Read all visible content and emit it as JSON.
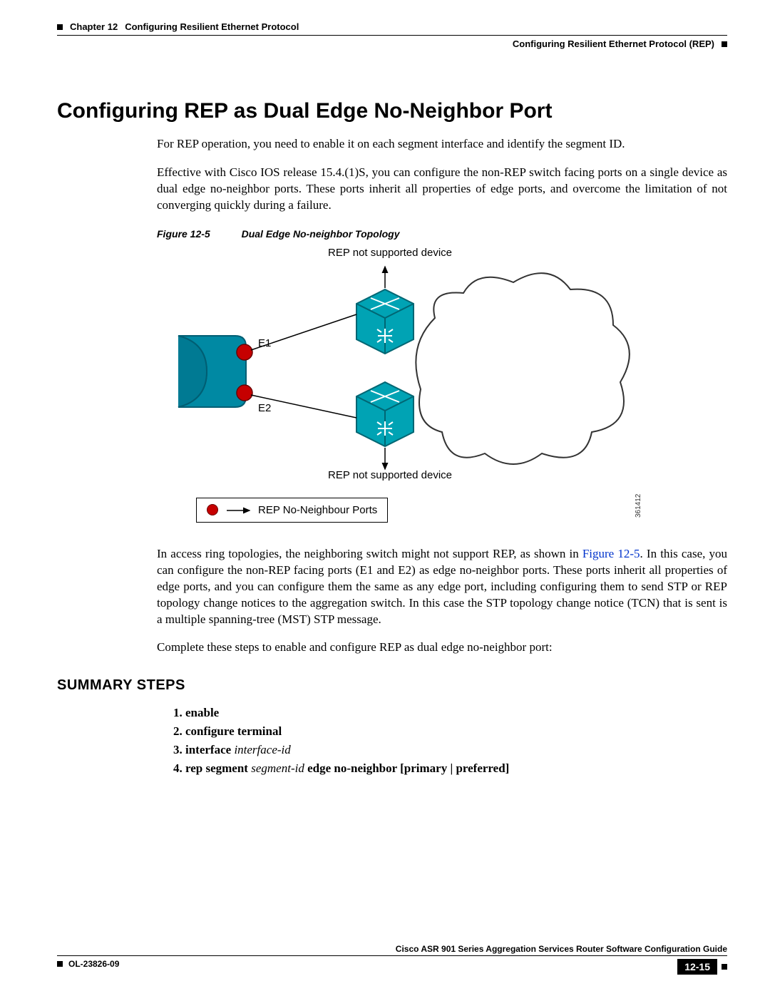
{
  "header": {
    "chapter": "Chapter 12",
    "chapter_title": "Configuring Resilient Ethernet Protocol",
    "breadcrumb": "Configuring Resilient Ethernet Protocol (REP)"
  },
  "section_title": "Configuring REP as Dual Edge No-Neighbor Port",
  "para1": "For REP operation, you need to enable it on each segment interface and identify the segment ID.",
  "para2": "Effective with Cisco IOS release 15.4.(1)S, you can configure the non-REP switch facing ports on a single device as dual edge no-neighbor ports. These ports inherit all properties of edge ports, and overcome the limitation of not converging quickly during a failure.",
  "figure": {
    "number": "Figure 12-5",
    "title": "Dual Edge No-neighbor Topology",
    "top_label": "REP not supported device",
    "bottom_label": "REP not supported device",
    "e1": "E1",
    "e2": "E2",
    "legend": "REP No-Neighbour Ports",
    "id": "361412"
  },
  "para3a": "In access ring topologies, the neighboring switch might not support REP, as shown in ",
  "para3_link": "Figure 12-5",
  "para3b": ". In this case, you can configure the non-REP facing ports (E1 and E2) as edge no-neighbor ports. These ports inherit all properties of edge ports, and you can configure them the same as any edge port, including configuring them to send STP or REP topology change notices to the aggregation switch. In this case the STP topology change notice (TCN) that is sent is a multiple spanning-tree (MST) STP message.",
  "para4": "Complete these steps to enable and configure REP as dual edge no-neighbor port:",
  "summary_heading": "SUMMARY STEPS",
  "steps": {
    "s1": "enable",
    "s2": "configure terminal",
    "s3a": "interface",
    "s3b": "interface-id",
    "s4a": "rep segment",
    "s4b": "segment-id",
    "s4c": "edge no-neighbor [primary | preferred]"
  },
  "footer": {
    "guide": "Cisco ASR 901 Series Aggregation Services Router Software Configuration Guide",
    "docid": "OL-23826-09",
    "page": "12-15"
  }
}
